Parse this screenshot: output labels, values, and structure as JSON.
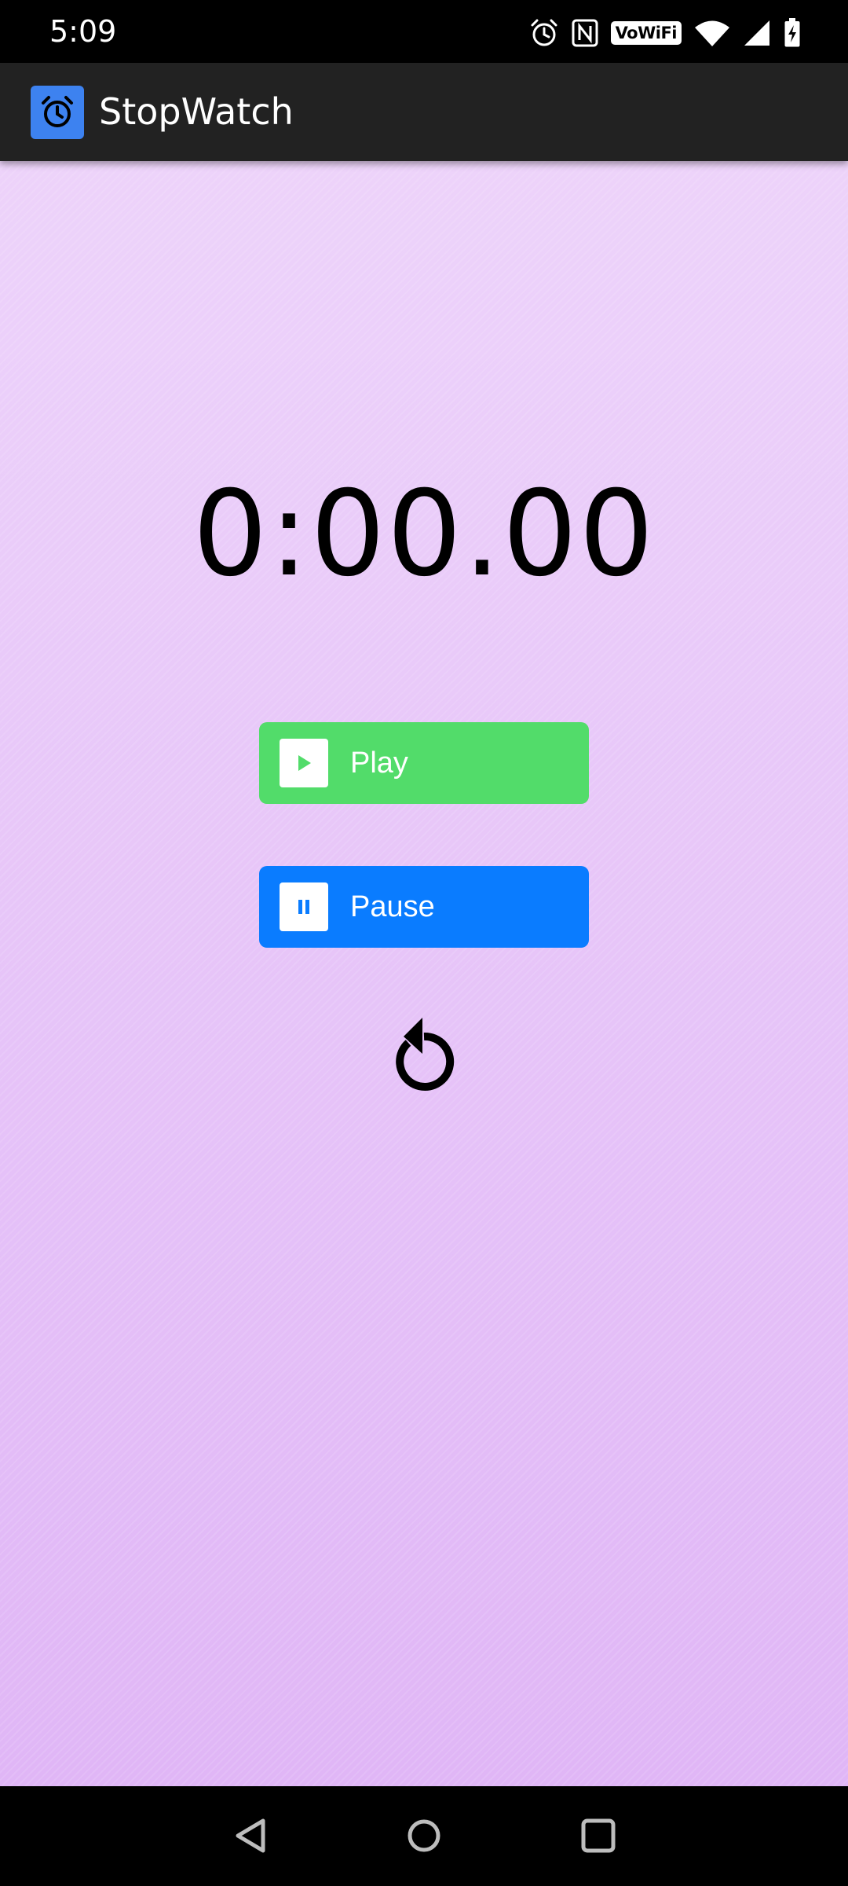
{
  "status_bar": {
    "time": "5:09",
    "wifi_label": "VoWiFi",
    "icons": [
      "alarm-icon",
      "nfc-icon",
      "vowifi-icon",
      "wifi-icon",
      "signal-icon",
      "battery-charging-icon"
    ]
  },
  "app_bar": {
    "title": "StopWatch",
    "icon": "alarm-clock-icon"
  },
  "stopwatch": {
    "time_display": "0:00.00",
    "play_label": "Play",
    "pause_label": "Pause",
    "reset_icon": "reset-icon"
  },
  "nav_bar": {
    "icons": [
      "back-icon",
      "home-icon",
      "recents-icon"
    ]
  },
  "colors": {
    "app_bar": "#222222",
    "app_icon": "#3d82f0",
    "background_top": "#edd3fa",
    "background_bottom": "#e0b6f6",
    "play_button": "#52dc6a",
    "pause_button": "#0a7cff"
  }
}
